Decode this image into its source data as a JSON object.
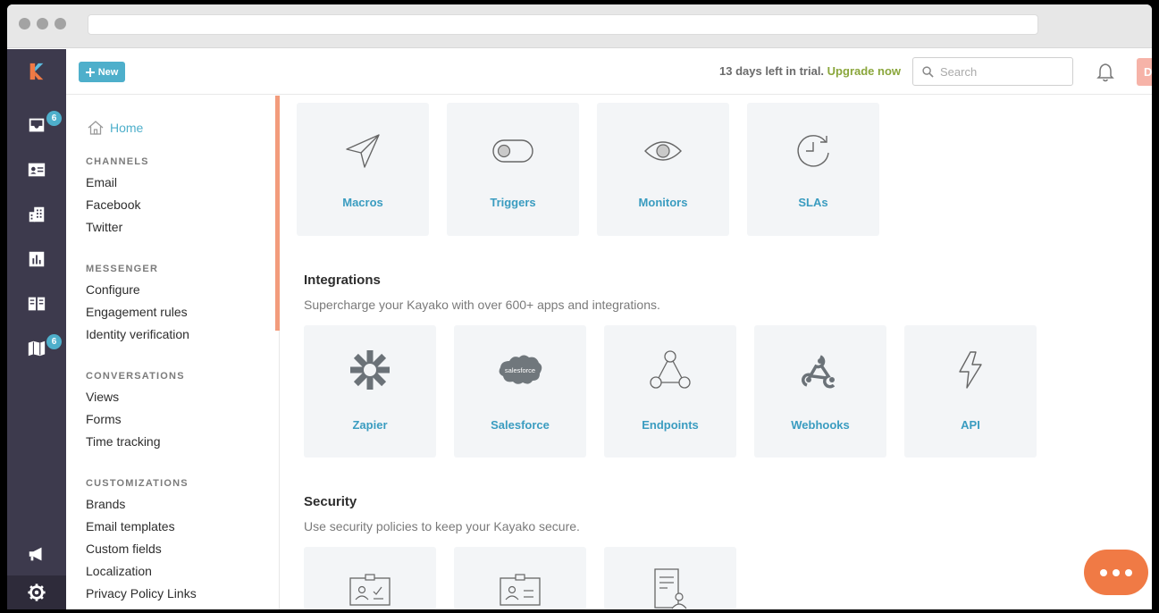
{
  "colors": {
    "accent": "#4eafcb",
    "upgrade": "#8aa63b",
    "rail_bg": "#3d3a4d",
    "chat": "#f07a45"
  },
  "rail": {
    "items": [
      {
        "icon": "inbox-icon",
        "badge": "6"
      },
      {
        "icon": "contact-card-icon",
        "badge": ""
      },
      {
        "icon": "organizations-icon",
        "badge": ""
      },
      {
        "icon": "insights-icon",
        "badge": ""
      },
      {
        "icon": "knowledge-base-icon",
        "badge": ""
      },
      {
        "icon": "map-icon",
        "badge": "6"
      }
    ],
    "bottom_icons": [
      "megaphone-icon",
      "gear-icon"
    ]
  },
  "topbar": {
    "new_label": "New",
    "trial_text": "13 days left in trial.",
    "upgrade_label": "Upgrade now",
    "search_placeholder": "Search",
    "avatar_initial": "D"
  },
  "sidebar": {
    "home_label": "Home",
    "sections": [
      {
        "title": "CHANNELS",
        "items": [
          "Email",
          "Facebook",
          "Twitter"
        ]
      },
      {
        "title": "MESSENGER",
        "items": [
          "Configure",
          "Engagement rules",
          "Identity verification"
        ]
      },
      {
        "title": "CONVERSATIONS",
        "items": [
          "Views",
          "Forms",
          "Time tracking"
        ]
      },
      {
        "title": "CUSTOMIZATIONS",
        "items": [
          "Brands",
          "Email templates",
          "Custom fields",
          "Localization",
          "Privacy Policy Links"
        ]
      }
    ]
  },
  "main": {
    "automation_cards": [
      {
        "label": "Macros",
        "icon": "paper-plane-icon"
      },
      {
        "label": "Triggers",
        "icon": "toggle-icon"
      },
      {
        "label": "Monitors",
        "icon": "eye-icon"
      },
      {
        "label": "SLAs",
        "icon": "clock-refresh-icon"
      }
    ],
    "integrations": {
      "title": "Integrations",
      "subtitle": "Supercharge your Kayako with over 600+ apps and integrations.",
      "cards": [
        {
          "label": "Zapier",
          "icon": "zapier-icon"
        },
        {
          "label": "Salesforce",
          "icon": "salesforce-icon",
          "icon_text": "salesforce"
        },
        {
          "label": "Endpoints",
          "icon": "endpoints-icon"
        },
        {
          "label": "Webhooks",
          "icon": "webhooks-icon"
        },
        {
          "label": "API",
          "icon": "lightning-icon"
        }
      ]
    },
    "security": {
      "title": "Security",
      "subtitle": "Use security policies to keep your Kayako secure.",
      "cards": [
        {
          "icon": "id-card-check-icon"
        },
        {
          "icon": "id-card-icon"
        },
        {
          "icon": "document-user-icon"
        }
      ]
    }
  }
}
